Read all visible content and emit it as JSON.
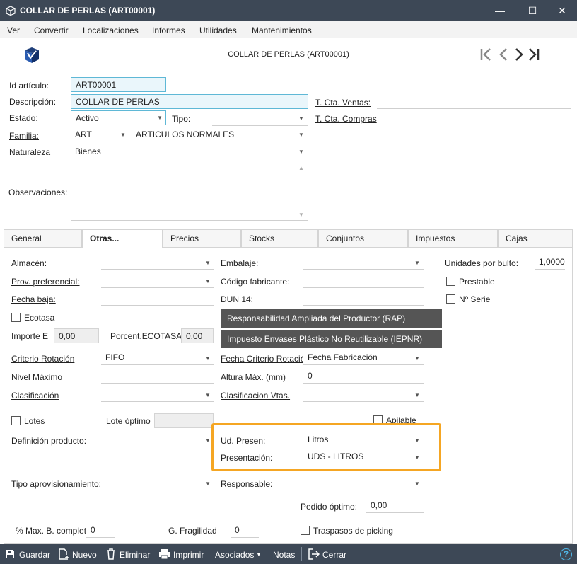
{
  "window": {
    "title": "COLLAR DE PERLAS (ART00001)",
    "minimize": "—",
    "maximize": "☐",
    "close": "✕"
  },
  "menu": [
    "Ver",
    "Convertir",
    "Localizaciones",
    "Informes",
    "Utilidades",
    "Mantenimientos"
  ],
  "header": {
    "title": "COLLAR DE PERLAS (ART00001)",
    "nav_first": "|<",
    "nav_prev": "<",
    "nav_next": ">",
    "nav_last": ">|"
  },
  "form": {
    "id_label": "Id artículo:",
    "id_value": "ART00001",
    "desc_label": "Descripción:",
    "desc_value": "COLLAR DE PERLAS",
    "estado_label": "Estado:",
    "estado_value": "Activo",
    "tipo_label": "Tipo:",
    "tipo_value": "",
    "familia_label": "Familia:",
    "familia_code": "ART",
    "familia_value": "ARTICULOS NORMALES",
    "naturaleza_label": "Naturaleza",
    "naturaleza_value": "Bienes",
    "observaciones_label": "Observaciones:",
    "cta_ventas_label": "T. Cta. Ventas:",
    "cta_compras_label": "T. Cta. Compras"
  },
  "tabs": [
    "General",
    "Otras...",
    "Precios",
    "Stocks",
    "Conjuntos",
    "Impuestos",
    "Cajas"
  ],
  "panel": {
    "almacen": "Almacén:",
    "prov": "Prov. preferencial:",
    "fecha_baja": "Fecha baja:",
    "ecotasa": "Ecotasa",
    "importe": "Importe  E",
    "importe_value": "0,00",
    "porcent": "Porcent.ECOTASA:",
    "porcent_value": "0,00",
    "criterio": "Criterio Rotación",
    "criterio_value": "FIFO",
    "nivel": "Nivel Máximo",
    "clasificacion": "Clasificación",
    "lotes": "Lotes",
    "lote_optimo": "Lote óptimo",
    "definicion": "Definición producto:",
    "tipo_aprov": "Tipo aprovisionamiento:",
    "max_b": "% Max. B. complet",
    "max_b_value": "0",
    "g_fragilidad": "G. Fragilidad",
    "g_fragilidad_value": "0",
    "embalaje": "Embalaje:",
    "codigo_fab": "Código fabricante:",
    "dun14": "DUN 14:",
    "rap": "Responsabilidad Ampliada del Productor (RAP)",
    "iepnr": "Impuesto Envases Plástico No Reutilizable (IEPNR)",
    "fecha_criterio": "Fecha Criterio Rotació",
    "fecha_criterio_value": "Fecha Fabricación",
    "altura": "Altura Máx. (mm)",
    "altura_value": "0",
    "clasif_vtas": "Clasificacion Vtas.",
    "apilable": "Apilable",
    "ud_presen": "Ud. Presen:",
    "ud_presen_value": "Litros",
    "presentacion": "Presentación:",
    "presentacion_value": "UDS - LITROS",
    "responsable": "Responsable:",
    "pedido_optimo": "Pedido óptimo:",
    "pedido_optimo_value": "0,00",
    "traspasos": "Traspasos de picking",
    "unidades_bulto": "Unidades por bulto:",
    "unidades_bulto_value": "1,0000",
    "prestable": "Prestable",
    "nserie": "Nº Serie"
  },
  "toolbar": {
    "guardar": "Guardar",
    "nuevo": "Nuevo",
    "eliminar": "Eliminar",
    "imprimir": "Imprimir",
    "asociados": "Asociados",
    "notas": "Notas",
    "cerrar": "Cerrar",
    "help": "?"
  },
  "colors": {
    "titlebar": "#3d4856",
    "accent": "#5fb8d6",
    "highlight": "#f5a623"
  }
}
